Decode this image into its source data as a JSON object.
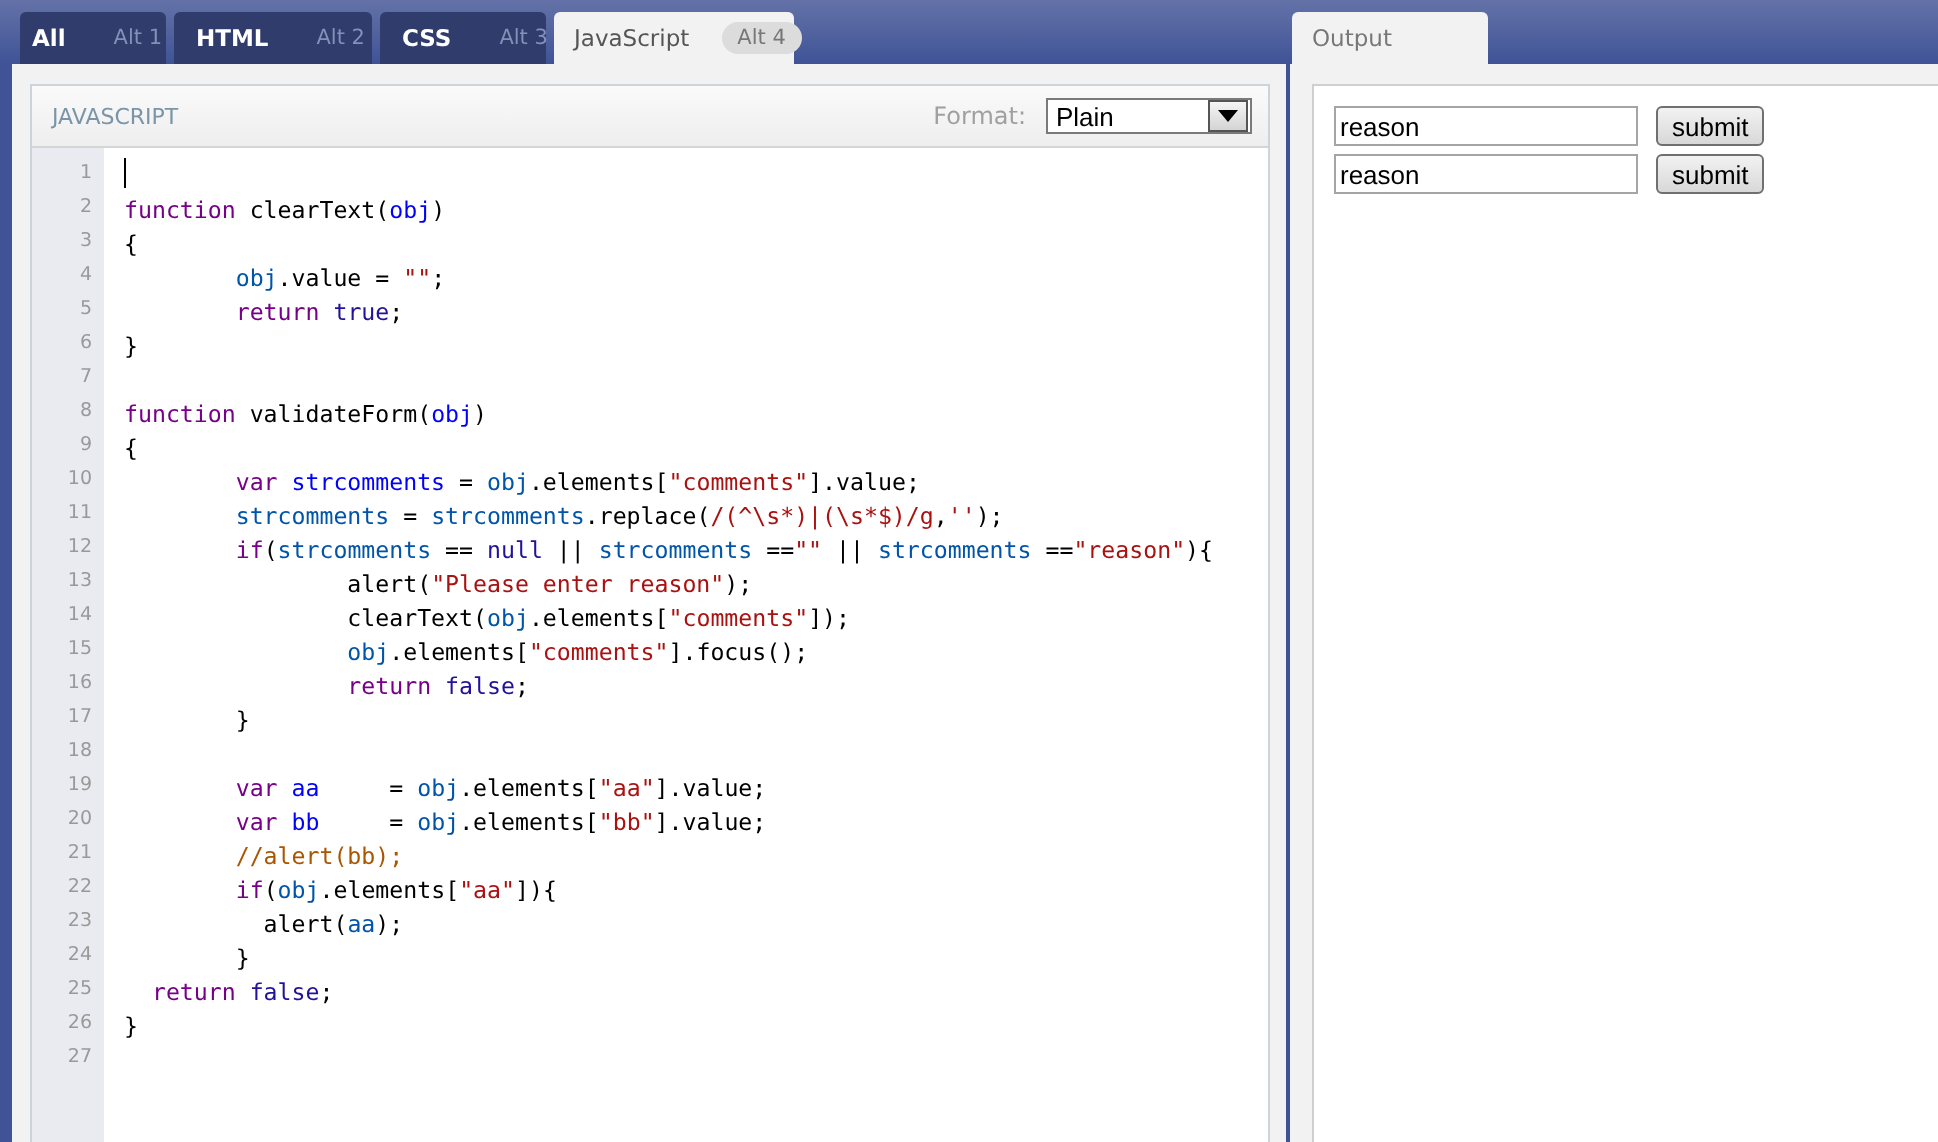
{
  "tabs": [
    {
      "label": "All",
      "shortcut": "Alt 1",
      "selected": false
    },
    {
      "label": "HTML",
      "shortcut": "Alt 2",
      "selected": false
    },
    {
      "label": "CSS",
      "shortcut": "Alt 3",
      "selected": false
    },
    {
      "label": "JavaScript",
      "shortcut": "Alt 4",
      "selected": true
    }
  ],
  "editor": {
    "title": "JAVASCRIPT",
    "format_label": "Format:",
    "format_value": "Plain",
    "lines": [
      {
        "number": "1",
        "cursor": true
      },
      {
        "number": "2",
        "cursor": false,
        "tokens": [
          {
            "text": "function",
            "kind": "keyword"
          },
          {
            "text": " clearText(",
            "kind": "plain"
          },
          {
            "text": "obj",
            "kind": "def"
          },
          {
            "text": ")",
            "kind": "plain"
          }
        ]
      },
      {
        "number": "3",
        "cursor": false,
        "tokens": [
          {
            "text": "{",
            "kind": "plain"
          }
        ]
      },
      {
        "number": "4",
        "cursor": false,
        "tokens": [
          {
            "text": "        obj",
            "kind": "variable"
          },
          {
            "text": ".value = ",
            "kind": "plain"
          },
          {
            "text": "\"\"",
            "kind": "string"
          },
          {
            "text": ";",
            "kind": "plain"
          }
        ]
      },
      {
        "number": "5",
        "cursor": false,
        "tokens": [
          {
            "text": "        return",
            "kind": "keyword"
          },
          {
            "text": " true",
            "kind": "atom"
          },
          {
            "text": ";",
            "kind": "plain"
          }
        ]
      },
      {
        "number": "6",
        "cursor": false,
        "tokens": [
          {
            "text": "}",
            "kind": "plain"
          }
        ]
      },
      {
        "number": "7",
        "cursor": false
      },
      {
        "number": "8",
        "cursor": false,
        "tokens": [
          {
            "text": "function",
            "kind": "keyword"
          },
          {
            "text": " validateForm(",
            "kind": "plain"
          },
          {
            "text": "obj",
            "kind": "def"
          },
          {
            "text": ")",
            "kind": "plain"
          }
        ]
      },
      {
        "number": "9",
        "cursor": false,
        "tokens": [
          {
            "text": "{",
            "kind": "plain"
          }
        ]
      },
      {
        "number": "10",
        "cursor": false,
        "tokens": [
          {
            "text": "        var",
            "kind": "keyword"
          },
          {
            "text": " strcomments",
            "kind": "def"
          },
          {
            "text": " = ",
            "kind": "plain"
          },
          {
            "text": "obj",
            "kind": "variable"
          },
          {
            "text": ".elements[",
            "kind": "plain"
          },
          {
            "text": "\"comments\"",
            "kind": "string"
          },
          {
            "text": "].value;",
            "kind": "plain"
          }
        ]
      },
      {
        "number": "11",
        "cursor": false,
        "tokens": [
          {
            "text": "        strcomments",
            "kind": "variable"
          },
          {
            "text": " = ",
            "kind": "plain"
          },
          {
            "text": "strcomments",
            "kind": "variable"
          },
          {
            "text": ".replace(",
            "kind": "plain"
          },
          {
            "text": "/(^\\s*)|(\\s*$)/g",
            "kind": "string"
          },
          {
            "text": ",",
            "kind": "plain"
          },
          {
            "text": "''",
            "kind": "string"
          },
          {
            "text": ");",
            "kind": "plain"
          }
        ]
      },
      {
        "number": "12",
        "cursor": false,
        "tokens": [
          {
            "text": "        if",
            "kind": "keyword"
          },
          {
            "text": "(",
            "kind": "plain"
          },
          {
            "text": "strcomments",
            "kind": "variable"
          },
          {
            "text": " == ",
            "kind": "plain"
          },
          {
            "text": "null",
            "kind": "atom"
          },
          {
            "text": " || ",
            "kind": "plain"
          },
          {
            "text": "strcomments",
            "kind": "variable"
          },
          {
            "text": " ==",
            "kind": "plain"
          },
          {
            "text": "\"\"",
            "kind": "string"
          },
          {
            "text": " || ",
            "kind": "plain"
          },
          {
            "text": "strcomments",
            "kind": "variable"
          },
          {
            "text": " ==",
            "kind": "plain"
          },
          {
            "text": "\"reason\"",
            "kind": "string"
          },
          {
            "text": "){",
            "kind": "plain"
          }
        ]
      },
      {
        "number": "13",
        "cursor": false,
        "tokens": [
          {
            "text": "                alert(",
            "kind": "plain"
          },
          {
            "text": "\"Please enter reason\"",
            "kind": "string"
          },
          {
            "text": ");",
            "kind": "plain"
          }
        ]
      },
      {
        "number": "14",
        "cursor": false,
        "tokens": [
          {
            "text": "                clearText(",
            "kind": "plain"
          },
          {
            "text": "obj",
            "kind": "variable"
          },
          {
            "text": ".elements[",
            "kind": "plain"
          },
          {
            "text": "\"comments\"",
            "kind": "string"
          },
          {
            "text": "]);",
            "kind": "plain"
          }
        ]
      },
      {
        "number": "15",
        "cursor": false,
        "tokens": [
          {
            "text": "                obj",
            "kind": "variable"
          },
          {
            "text": ".elements[",
            "kind": "plain"
          },
          {
            "text": "\"comments\"",
            "kind": "string"
          },
          {
            "text": "].focus();",
            "kind": "plain"
          }
        ]
      },
      {
        "number": "16",
        "cursor": false,
        "tokens": [
          {
            "text": "                return",
            "kind": "keyword"
          },
          {
            "text": " false",
            "kind": "atom"
          },
          {
            "text": ";",
            "kind": "plain"
          }
        ]
      },
      {
        "number": "17",
        "cursor": false,
        "tokens": [
          {
            "text": "        }",
            "kind": "plain"
          }
        ]
      },
      {
        "number": "18",
        "cursor": false
      },
      {
        "number": "19",
        "cursor": false,
        "tokens": [
          {
            "text": "        var",
            "kind": "keyword"
          },
          {
            "text": " aa",
            "kind": "def"
          },
          {
            "text": "     = ",
            "kind": "plain"
          },
          {
            "text": "obj",
            "kind": "variable"
          },
          {
            "text": ".elements[",
            "kind": "plain"
          },
          {
            "text": "\"aa\"",
            "kind": "string"
          },
          {
            "text": "].value;",
            "kind": "plain"
          }
        ]
      },
      {
        "number": "20",
        "cursor": false,
        "tokens": [
          {
            "text": "        var",
            "kind": "keyword"
          },
          {
            "text": " bb",
            "kind": "def"
          },
          {
            "text": "     = ",
            "kind": "plain"
          },
          {
            "text": "obj",
            "kind": "variable"
          },
          {
            "text": ".elements[",
            "kind": "plain"
          },
          {
            "text": "\"bb\"",
            "kind": "string"
          },
          {
            "text": "].value;",
            "kind": "plain"
          }
        ]
      },
      {
        "number": "21",
        "cursor": false,
        "tokens": [
          {
            "text": "        //alert(bb);",
            "kind": "comment"
          }
        ]
      },
      {
        "number": "22",
        "cursor": false,
        "tokens": [
          {
            "text": "        if",
            "kind": "keyword"
          },
          {
            "text": "(",
            "kind": "plain"
          },
          {
            "text": "obj",
            "kind": "variable"
          },
          {
            "text": ".elements[",
            "kind": "plain"
          },
          {
            "text": "\"aa\"",
            "kind": "string"
          },
          {
            "text": "]){",
            "kind": "plain"
          }
        ]
      },
      {
        "number": "23",
        "cursor": false,
        "tokens": [
          {
            "text": "          alert(",
            "kind": "plain"
          },
          {
            "text": "aa",
            "kind": "variable"
          },
          {
            "text": ");",
            "kind": "plain"
          }
        ]
      },
      {
        "number": "24",
        "cursor": false,
        "tokens": [
          {
            "text": "        }",
            "kind": "plain"
          }
        ]
      },
      {
        "number": "25",
        "cursor": false,
        "tokens": [
          {
            "text": "  return",
            "kind": "keyword"
          },
          {
            "text": " false",
            "kind": "atom"
          },
          {
            "text": ";",
            "kind": "plain"
          }
        ]
      },
      {
        "number": "26",
        "cursor": false,
        "tokens": [
          {
            "text": "}",
            "kind": "plain"
          }
        ]
      },
      {
        "number": "27",
        "cursor": false
      }
    ]
  },
  "output": {
    "tab": {
      "label": "Output",
      "selected": true
    },
    "rows": [
      {
        "value": "reason",
        "button": "submit"
      },
      {
        "value": "reason",
        "button": "submit"
      }
    ]
  }
}
